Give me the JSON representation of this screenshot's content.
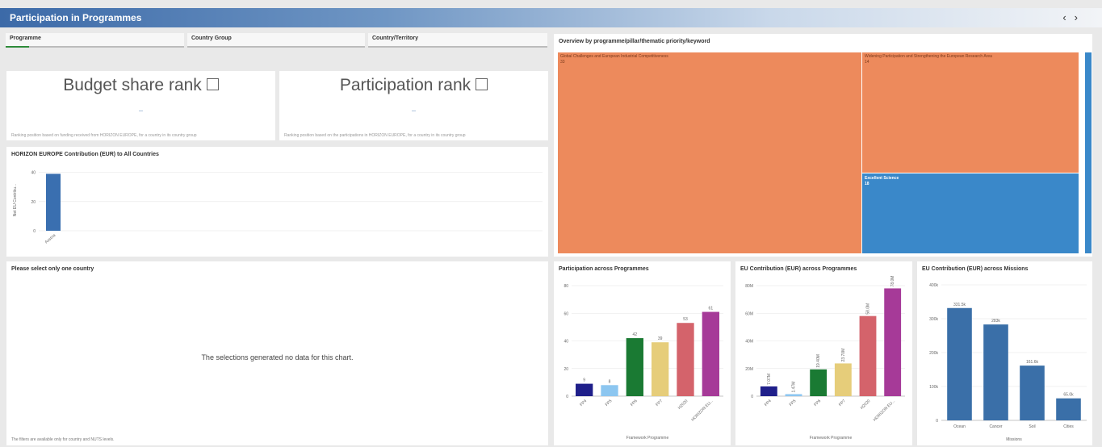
{
  "app": {
    "title": "Participation in Programmes",
    "nav_prev": "‹",
    "nav_next": "›"
  },
  "filters": [
    {
      "label": "Programme",
      "progress": 0.13
    },
    {
      "label": "Country Group"
    },
    {
      "label": "Country/Territory"
    }
  ],
  "kpis": [
    {
      "title": "Budget share rank",
      "value_dash": "—",
      "foot": "Ranking position based on funding received from HORIZON EUROPE, for a country in its country group",
      "icon": "external-link-icon"
    },
    {
      "title": "Participation rank",
      "value_dash": "—",
      "foot": "Ranking position based on the participations in HORIZON EUROPE, for a country in its country group",
      "icon": "external-link-icon"
    }
  ],
  "contribution_chart": {
    "title": "HORIZON EUROPE Contribution (EUR) to All Countries",
    "ylabel": "Net EU Contribu...",
    "yticks": [
      "0",
      "20",
      "40"
    ],
    "chart_data": {
      "type": "bar",
      "categories": [
        "Austria"
      ],
      "values": [
        39
      ],
      "ylim": [
        0,
        42
      ],
      "color": "#3a6fb0"
    }
  },
  "country_panel": {
    "title": "Please select only one country",
    "message": "The selections generated no data for this chart.",
    "footnote": "The filters are available only for country and NUTS levels."
  },
  "treemap": {
    "title": "Overview by programme/pillar/thematic priority/keyword",
    "cells": [
      {
        "label": "Global Challenges and European Industrial Competitiveness",
        "value": "33",
        "color": "#ed8a5c"
      },
      {
        "label": "Widening Participation and Strengthening the European Research Area",
        "value": "14",
        "color": "#ed8a5c"
      },
      {
        "label": "Excellent Science",
        "value": "18",
        "color": "#3a88c9"
      }
    ]
  },
  "participation_chart": {
    "title": "Participation across Programmes",
    "xlabel": "Framework Programme",
    "yticks": [
      "0",
      "20",
      "40",
      "60",
      "80"
    ],
    "chart_data": {
      "type": "bar",
      "categories": [
        "FP4",
        "FP5",
        "FP6",
        "FP7",
        "H2020",
        "HORIZON EU..."
      ],
      "values": [
        9,
        8,
        42,
        39,
        53,
        61
      ],
      "labels": [
        "9",
        "8",
        "42",
        "39",
        "53",
        "61"
      ],
      "colors": [
        "#1f1f8a",
        "#8cc6f0",
        "#1a7a33",
        "#e6cd7a",
        "#d4636b",
        "#a63a98"
      ],
      "ylim": [
        0,
        80
      ]
    }
  },
  "eu_contrib_chart": {
    "title": "EU Contribution (EUR) across Programmes",
    "xlabel": "Framework Programme",
    "yticks": [
      "0",
      "20M",
      "40M",
      "60M",
      "80M"
    ],
    "chart_data": {
      "type": "bar",
      "categories": [
        "FP4",
        "FP5",
        "FP6",
        "FP7",
        "H2020",
        "HORIZON EU..."
      ],
      "values": [
        7.07,
        1.47,
        19.4,
        23.7,
        58.0,
        78.0
      ],
      "labels": [
        "7.07M",
        "1.47M",
        "19.40M",
        "23.70M",
        "58.0M",
        "78.0M"
      ],
      "colors": [
        "#1f1f8a",
        "#8cc6f0",
        "#1a7a33",
        "#e6cd7a",
        "#d4636b",
        "#a63a98"
      ],
      "ylim": [
        0,
        80
      ]
    }
  },
  "missions_chart": {
    "title": "EU Contribution (EUR) across Missions",
    "xlabel": "Missions",
    "yticks": [
      "0",
      "100k",
      "200k",
      "300k",
      "400k"
    ],
    "chart_data": {
      "type": "bar",
      "categories": [
        "Ocean",
        "Cancer",
        "Soil",
        "Cities"
      ],
      "values": [
        331.5,
        283.0,
        161.6,
        65.0
      ],
      "labels": [
        "331.5k",
        "283k",
        "161.6k",
        "65.0k"
      ],
      "color": "#3a6fa8",
      "ylim": [
        0,
        400
      ]
    }
  }
}
